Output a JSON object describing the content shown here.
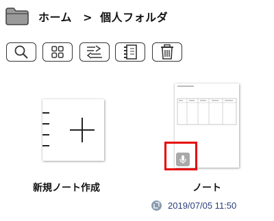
{
  "breadcrumb": {
    "root": "ホーム",
    "separator": ">",
    "current": "個人フォルダ"
  },
  "toolbar": {
    "search_icon": "search-icon",
    "grid_icon": "grid-view-icon",
    "sort_icon": "sort-icon",
    "notebook_icon": "notebook-icon",
    "trash_icon": "trash-icon"
  },
  "items": [
    {
      "label": "新規ノート作成",
      "icon": "new-note-icon"
    },
    {
      "label": "ノート",
      "icon": "note-thumbnail",
      "updated": "2019/07/05 11:50"
    }
  ],
  "colors": {
    "highlight": "#e60000",
    "date_text": "#2a3d7a",
    "mic_badge": "#a9a9a9"
  }
}
